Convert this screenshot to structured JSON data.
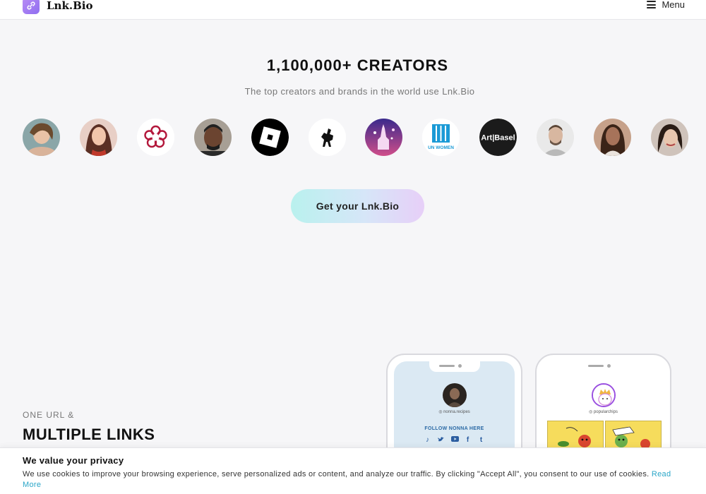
{
  "header": {
    "brand": "Lnk.Bio",
    "menu_label": "Menu"
  },
  "hero": {
    "title": "1,100,000+ CREATORS",
    "subtitle": "The top creators and brands in the world use Lnk.Bio",
    "cta_label": "Get your Lnk.Bio",
    "avatars": [
      {
        "name": "creator-1",
        "label": ""
      },
      {
        "name": "creator-2",
        "label": ""
      },
      {
        "name": "michelin",
        "label": ""
      },
      {
        "name": "creator-omarion",
        "label": ""
      },
      {
        "name": "roblox",
        "label": ""
      },
      {
        "name": "ferrari",
        "label": ""
      },
      {
        "name": "disney",
        "label": ""
      },
      {
        "name": "un-women",
        "label": "UN WOMEN"
      },
      {
        "name": "art-basel",
        "label": "Art|Basel"
      },
      {
        "name": "creator-3",
        "label": ""
      },
      {
        "name": "creator-4",
        "label": ""
      },
      {
        "name": "creator-5",
        "label": ""
      }
    ]
  },
  "feature": {
    "kicker": "ONE URL &",
    "heading": "MULTIPLE LINKS"
  },
  "phones": {
    "a": {
      "handle": "nonna.recipes",
      "follow": "FOLLOW NONNA HERE"
    },
    "b": {
      "handle": "popularchips"
    }
  },
  "cookie": {
    "title": "We value your privacy",
    "text": "We use cookies to improve your browsing experience, serve personalized ads or content, and analyze our traffic. By clicking \"Accept All\", you consent to our use of cookies.",
    "link": "Read More"
  },
  "colors": {
    "brand": "#9b78f2",
    "link": "#2aa6c8"
  }
}
